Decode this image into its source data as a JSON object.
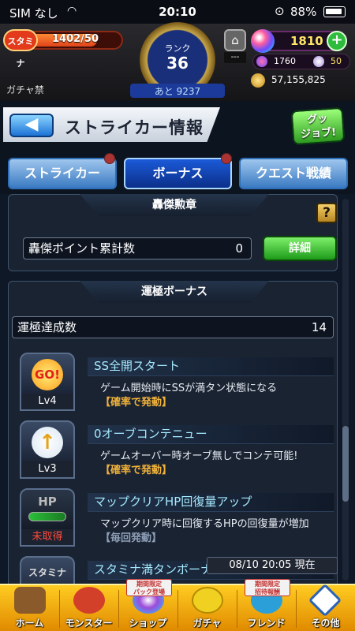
{
  "status_bar": {
    "carrier": "SIM なし",
    "time": "20:10",
    "battery": "88%"
  },
  "header": {
    "stamina_label": "スタミナ",
    "stamina_value": "1402/50",
    "stamina_fill_fraction": 0.8,
    "rank_label": "ランク",
    "rank_value": "36",
    "rank_remaining": "あと 9237",
    "gacha_ban": "ガチャ禁",
    "bank_value": "---",
    "orbs": "1810",
    "sub_a": "1760",
    "sub_b": "50",
    "gold": "57,155,825"
  },
  "title": {
    "back_label": "◀",
    "page_title": "ストライカー情報",
    "good_job_label": "グッ\nジョブ!"
  },
  "tabs": [
    {
      "label": "ストライカー",
      "selected": false
    },
    {
      "label": "ボーナス",
      "selected": true
    },
    {
      "label": "クエスト戦績",
      "selected": false
    }
  ],
  "honor_section": {
    "header": "轟傑勲章",
    "help": "?",
    "points_label": "轟傑ポイント累計数",
    "points_value": "0",
    "detail_label": "詳細"
  },
  "luck_section": {
    "header": "運極ボーナス",
    "count_label": "運極達成数",
    "count_value": "14",
    "bonuses": [
      {
        "icon_text": "GO!",
        "level": "Lv4",
        "title": "SS全開スタート",
        "desc": "ゲーム開始時にSSが満タン状態になる",
        "note": "【確率で発動】"
      },
      {
        "icon_text": "↑",
        "level": "Lv3",
        "title": "0オーブコンテニュー",
        "desc": "ゲームオーバー時オーブ無しでコンテ可能!",
        "note": "【確率で発動】"
      },
      {
        "icon_text": "HP",
        "level": "未取得",
        "title": "マップクリアHP回復量アップ",
        "desc": "マップクリア時に回復するHPの回復量が増加",
        "note": "【毎回発動】"
      },
      {
        "icon_text": "スタミナ",
        "level": "",
        "title": "スタミナ満タンボーナス",
        "desc": "",
        "note": ""
      }
    ],
    "timestamp": "08/10 20:05 現在"
  },
  "bottom_nav": [
    {
      "label": "ホーム",
      "tag": "",
      "color": "#8a5a2a"
    },
    {
      "label": "モンスター",
      "tag": "",
      "color": "#d2402a"
    },
    {
      "label": "ショップ",
      "tag": "期間限定\nパック登場",
      "color": "#9b4bd9"
    },
    {
      "label": "ガチャ",
      "tag": "",
      "color": "#f0d020"
    },
    {
      "label": "フレンド",
      "tag": "期間限定\n招待報酬",
      "color": "#2ba0d8"
    },
    {
      "label": "その他",
      "tag": "",
      "color": "#2a63b8"
    }
  ]
}
